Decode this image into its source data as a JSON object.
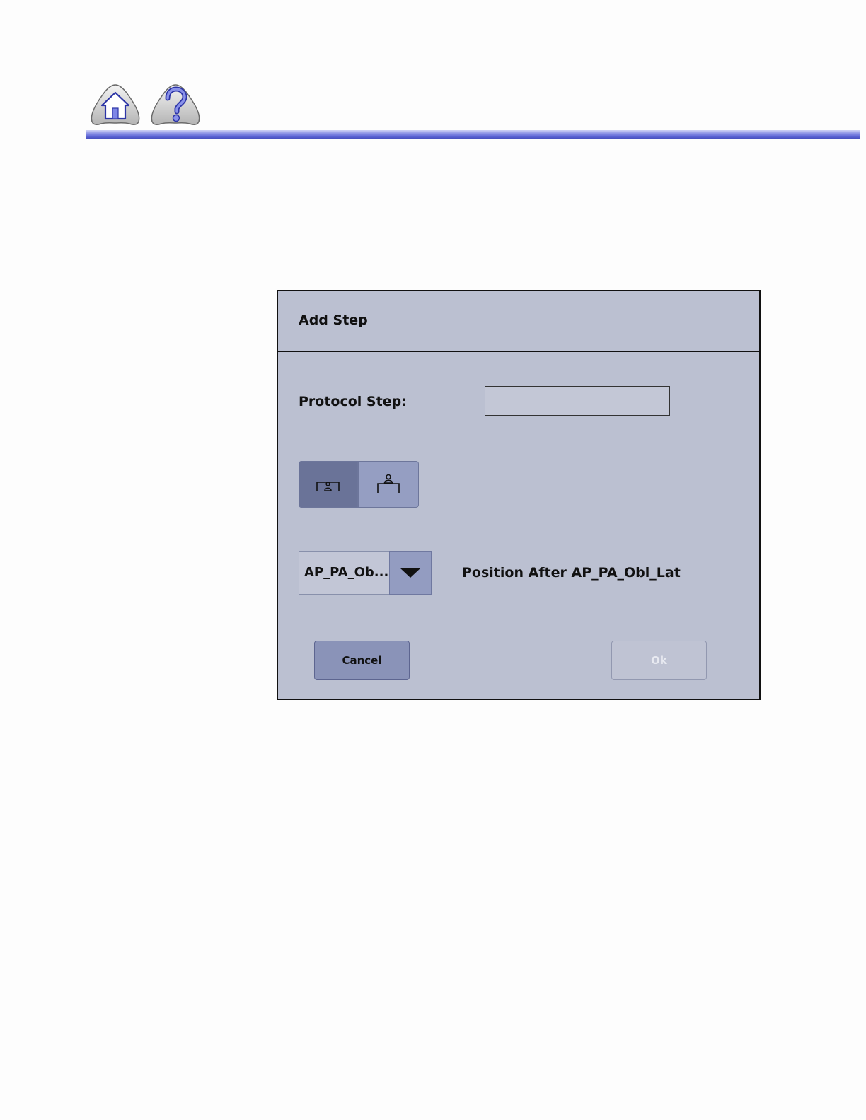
{
  "nav": {
    "home_icon": "home-icon",
    "help_icon": "help-icon"
  },
  "dialog": {
    "title": "Add Step",
    "protocol_step_label": "Protocol Step:",
    "protocol_step_value": "",
    "orientation_buttons": [
      {
        "icon": "patient-under-table-icon",
        "selected": true
      },
      {
        "icon": "patient-on-table-icon",
        "selected": false
      }
    ],
    "position_dropdown": {
      "selected": "AP_PA_Ob...",
      "icon": "chevron-down-icon"
    },
    "position_text": "Position After AP_PA_Obl_Lat",
    "cancel_label": "Cancel",
    "ok_label": "Ok",
    "ok_enabled": false
  },
  "colors": {
    "dialog_bg": "#bbc0d1",
    "selected_segment": "#6a7398",
    "button_accent": "#8a93b8",
    "header_rule": "#5d65d6"
  }
}
